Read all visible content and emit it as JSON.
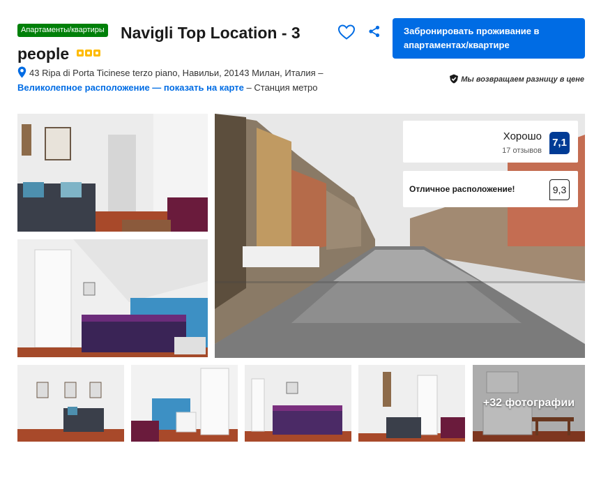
{
  "property": {
    "type_badge": "Апартаменты/квартиры",
    "name": "Navigli Top Location - 3 people",
    "stars": 3,
    "star_color": "#febb02",
    "address_text": "43 Ripa di Porta Ticinese terzo piano, Навильи, 20143 Милан, Италия –",
    "location_link": "Великолепное расположение — показать на карте",
    "address_suffix": "– Станция метро"
  },
  "actions": {
    "book_button": "Забронировать проживание в апартаментах/квартире",
    "price_match": "Мы возвращаем разницу в цене",
    "save_icon": "heart-icon",
    "share_icon": "share-icon"
  },
  "review": {
    "word": "Хорошо",
    "count": "17 отзывов",
    "score": "7,1",
    "score_color": "#003b95",
    "location_label": "Отличное расположение!",
    "location_score": "9,3"
  },
  "gallery": {
    "more_photos": "+32 фотографии"
  },
  "colors": {
    "primary": "#006ce4",
    "badge": "#008009"
  }
}
